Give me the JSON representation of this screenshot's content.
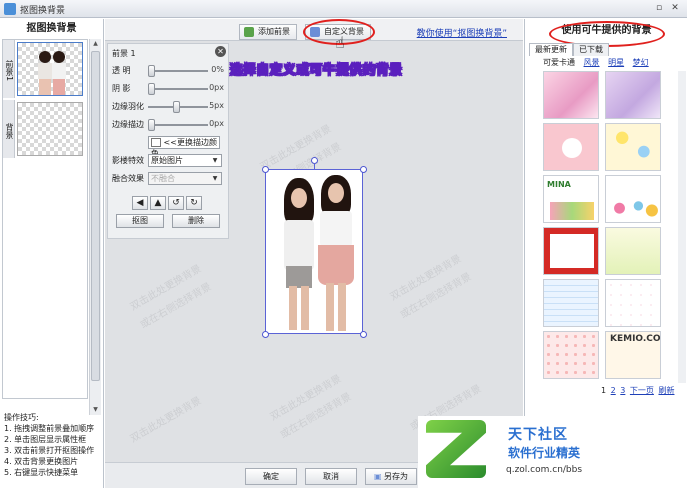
{
  "window": {
    "title": "抠图换背景"
  },
  "left": {
    "header": "抠图换背景",
    "layers": [
      {
        "label": "前景1"
      },
      {
        "label": "背景"
      }
    ],
    "tips_title": "操作技巧:",
    "tips": [
      "1. 拖拽调整前景叠加顺序",
      "2. 单击图层显示属性框",
      "3. 双击前景打开抠图操作",
      "4. 双击背景更换图片",
      "5. 右键显示快捷菜单"
    ]
  },
  "toolbar": {
    "add_foreground": "添加前景",
    "custom_background": "自定义背景",
    "help_link": "教你使用“抠图换背景”"
  },
  "annotation": "6.选择自定义或可牛提供的背景",
  "props": {
    "title": "前景 1",
    "rows": [
      {
        "label": "透 明",
        "value": "0%"
      },
      {
        "label": "阴 影",
        "value": "0px"
      },
      {
        "label": "边缘羽化",
        "value": "5px"
      },
      {
        "label": "边缘描边",
        "value": "0px"
      }
    ],
    "color_button": "<<更换描边颜色",
    "effect_label": "影楼特效",
    "effect_value": "原始图片",
    "blend_label": "融合效果",
    "blend_value": "不融合",
    "cutout_button": "抠图",
    "delete_button": "删除"
  },
  "watermark_text": [
    "双击此处更换背景",
    "或在右侧选择背景"
  ],
  "bottom": {
    "ok": "确定",
    "cancel": "取消",
    "save_as": "另存为"
  },
  "right": {
    "header": "使用可牛提供的背景",
    "tabs": [
      {
        "label": "最新更新"
      },
      {
        "label": "已下载"
      }
    ],
    "categories": [
      {
        "label": "可爱卡通",
        "link": false
      },
      {
        "label": "风景",
        "link": true
      },
      {
        "label": "明星",
        "link": true
      },
      {
        "label": "梦幻",
        "link": true
      }
    ],
    "tile_texts": {
      "mina": "MINA",
      "kemio": "KEMIO.COM"
    },
    "pager": {
      "p1": "1",
      "p2": "2",
      "p3": "3",
      "next": "下一页",
      "refresh": "刷新"
    }
  },
  "logo": {
    "line1": "天下社区",
    "line2": "软件行业精英",
    "url": "q.zol.com.cn/bbs"
  },
  "colors": {
    "accent_red": "#e0201d",
    "link_blue": "#1e40b8",
    "annotation_yellow": "#f2ec28",
    "selection_blue": "#5b63d6"
  }
}
